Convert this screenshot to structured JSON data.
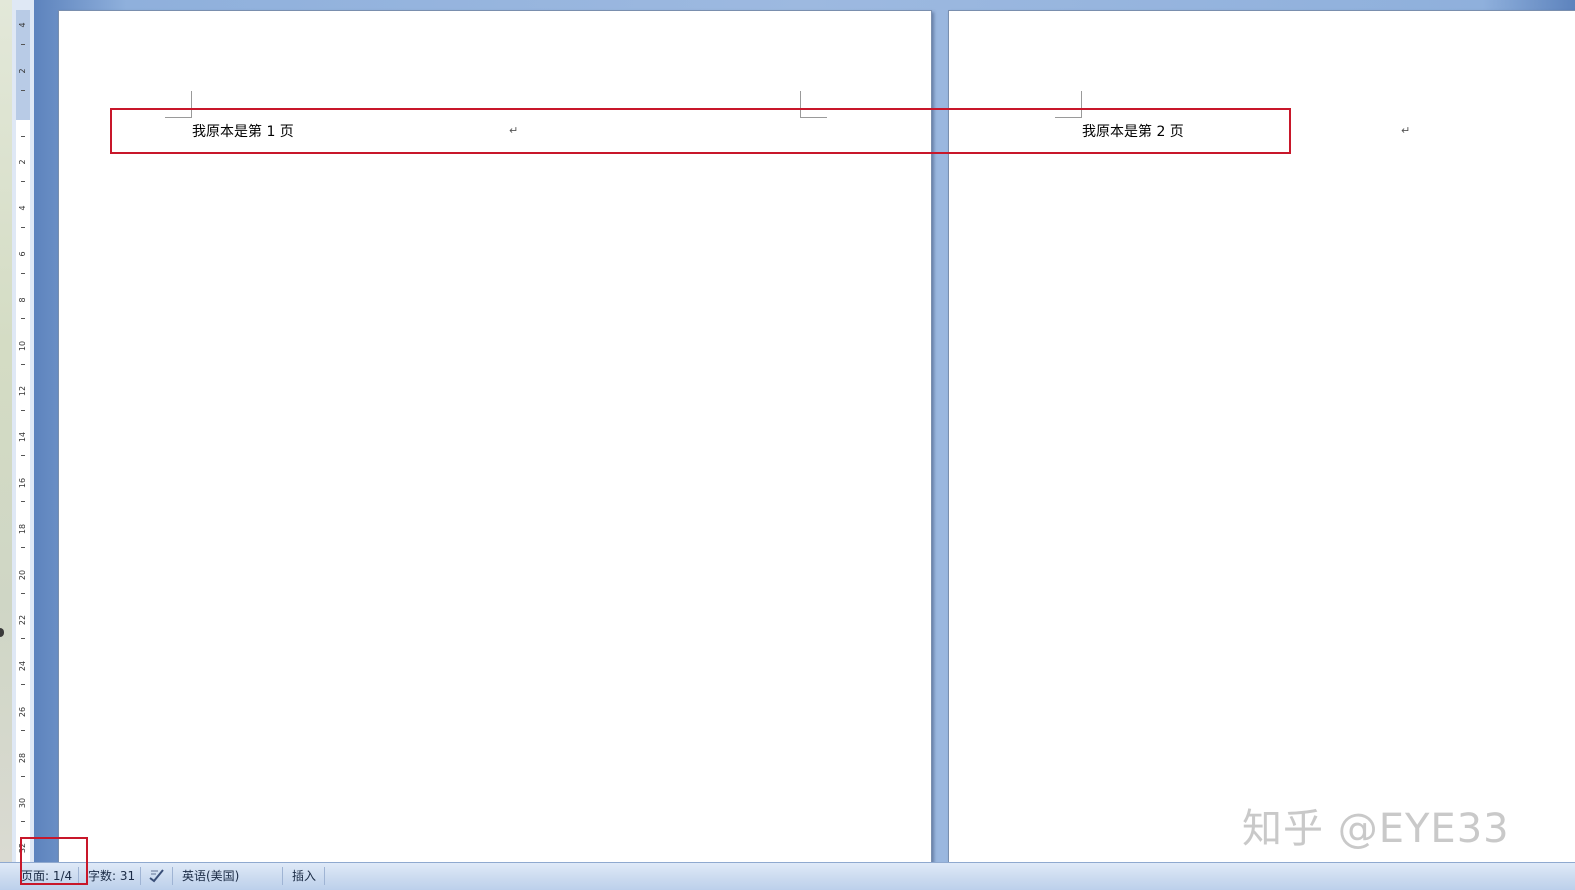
{
  "document": {
    "page1_text": "我原本是第 1 页",
    "page2_text": "我原本是第 2 页",
    "paragraph_mark": "↵"
  },
  "ruler": {
    "labels": [
      "4",
      "2",
      "2",
      "4",
      "6",
      "8",
      "10",
      "12",
      "14",
      "16",
      "18",
      "20",
      "22",
      "24",
      "26",
      "28",
      "30",
      "32"
    ]
  },
  "statusbar": {
    "page": "页面: 1/4",
    "word_count": "字数: 31",
    "proofing_icon": "spell-check-icon",
    "language": "英语(美国)",
    "mode": "插入"
  },
  "watermark": "知乎 @EYE33",
  "colors": {
    "highlight": "#c8172a",
    "workspace": "#9db9e0",
    "statusbar": "#cddcf0"
  }
}
